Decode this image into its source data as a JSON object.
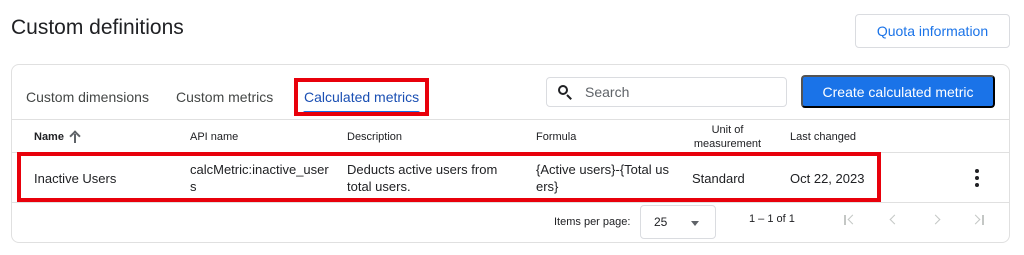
{
  "page": {
    "title": "Custom definitions"
  },
  "toolbar": {
    "quota_label": "Quota information",
    "create_label": "Create calculated metric"
  },
  "tabs": [
    {
      "label": "Custom dimensions",
      "selected": false
    },
    {
      "label": "Custom metrics",
      "selected": false
    },
    {
      "label": "Calculated metrics",
      "selected": true
    }
  ],
  "search": {
    "placeholder": "Search",
    "value": ""
  },
  "table": {
    "columns": [
      "Name",
      "API name",
      "Description",
      "Formula",
      "Unit of measurement",
      "Last changed"
    ],
    "sort": {
      "column": "Name",
      "direction": "ascending"
    },
    "rows": [
      {
        "name": "Inactive Users",
        "api_name": "calcMetric:inactive_users",
        "description": "Deducts active users from total users.",
        "formula": "{Active users}-{Total users}",
        "unit": "Standard",
        "last_changed": "Oct 22, 2023"
      }
    ]
  },
  "pagination": {
    "items_per_page_label": "Items per page:",
    "page_size": "25",
    "range": "1 – 1 of 1"
  },
  "icons": {
    "search": "search-icon",
    "sort": "arrow-up-icon",
    "more": "more-vert-icon",
    "first": "first-page-icon",
    "prev": "chevron-left-icon",
    "next": "chevron-right-icon",
    "last": "last-page-icon"
  },
  "colors": {
    "accent": "#1a73e8",
    "highlight": "#e8000b",
    "selected_tab_text": "#1a4fb3"
  }
}
